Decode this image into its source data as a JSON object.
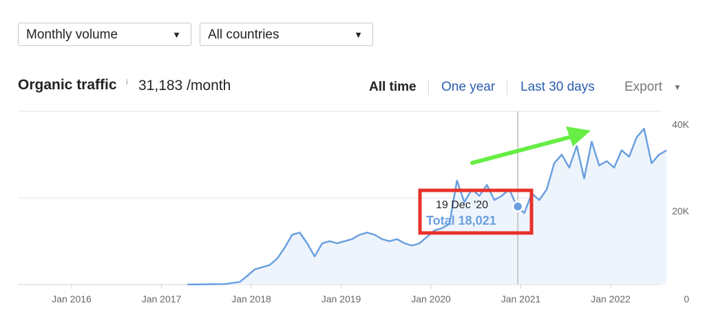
{
  "filters": {
    "volume": {
      "value": "Monthly volume"
    },
    "country": {
      "value": "All countries"
    }
  },
  "header": {
    "title": "Organic traffic",
    "info_mark": "i",
    "total": "31,183 /month"
  },
  "ranges": {
    "all": "All time",
    "year": "One year",
    "days30": "Last 30 days",
    "active": "All time"
  },
  "export": {
    "label": "Export"
  },
  "icons": {
    "dropdown": "caret-down-icon",
    "info": "info-icon"
  },
  "colors": {
    "line": "#6a9fe0",
    "area": "#eef4fc",
    "annotation_box": "#e8312a",
    "trend_arrow": "#66ee44",
    "link": "#2a5db0"
  },
  "tooltip": {
    "date": "19 Dec '20",
    "total": "Total 18,021"
  },
  "chart_data": {
    "type": "area",
    "title": "Organic traffic",
    "xlabel": "",
    "ylabel": "",
    "ylim": [
      0,
      40000
    ],
    "y_ticks": [
      "40K",
      "20K",
      "0"
    ],
    "x_ticks": [
      "Jan 2016",
      "Jan 2017",
      "Jan 2018",
      "Jan 2019",
      "Jan 2020",
      "Jan 2021",
      "Jan 2022"
    ],
    "grid": true,
    "series": [
      {
        "points": [
          [
            "2017-04",
            0
          ],
          [
            "2017-09",
            100
          ],
          [
            "2017-11",
            600
          ],
          [
            "2017-12",
            2000
          ],
          [
            "2018-01",
            3500
          ],
          [
            "2018-02",
            4000
          ],
          [
            "2018-03",
            4500
          ],
          [
            "2018-04",
            6000
          ],
          [
            "2018-05",
            8500
          ],
          [
            "2018-06",
            11500
          ],
          [
            "2018-07",
            12000
          ],
          [
            "2018-08",
            9500
          ],
          [
            "2018-09",
            6500
          ],
          [
            "2018-10",
            9500
          ],
          [
            "2018-11",
            10000
          ],
          [
            "2018-12",
            9500
          ],
          [
            "2019-01",
            10000
          ],
          [
            "2019-02",
            10500
          ],
          [
            "2019-03",
            11500
          ],
          [
            "2019-04",
            12000
          ],
          [
            "2019-05",
            11500
          ],
          [
            "2019-06",
            10500
          ],
          [
            "2019-07",
            10000
          ],
          [
            "2019-08",
            10500
          ],
          [
            "2019-09",
            9500
          ],
          [
            "2019-10",
            9000
          ],
          [
            "2019-11",
            9500
          ],
          [
            "2019-12",
            11000
          ],
          [
            "2020-01",
            12500
          ],
          [
            "2020-02",
            13000
          ],
          [
            "2020-03",
            14000
          ],
          [
            "2020-04",
            24000
          ],
          [
            "2020-05",
            19000
          ],
          [
            "2020-06",
            22000
          ],
          [
            "2020-07",
            20500
          ],
          [
            "2020-08",
            23000
          ],
          [
            "2020-09",
            19500
          ],
          [
            "2020-10",
            20500
          ],
          [
            "2020-11",
            22000
          ],
          [
            "2020-12",
            18021
          ],
          [
            "2021-01",
            16500
          ],
          [
            "2021-02",
            21000
          ],
          [
            "2021-03",
            19500
          ],
          [
            "2021-04",
            22000
          ],
          [
            "2021-05",
            28000
          ],
          [
            "2021-06",
            30000
          ],
          [
            "2021-07",
            27000
          ],
          [
            "2021-08",
            32000
          ],
          [
            "2021-09",
            24500
          ],
          [
            "2021-10",
            33000
          ],
          [
            "2021-11",
            27500
          ],
          [
            "2021-12",
            28500
          ],
          [
            "2022-01",
            27000
          ],
          [
            "2022-02",
            31000
          ],
          [
            "2022-03",
            29500
          ],
          [
            "2022-04",
            34000
          ],
          [
            "2022-05",
            36000
          ],
          [
            "2022-06",
            28000
          ],
          [
            "2022-07",
            30000
          ],
          [
            "2022-08",
            31000
          ]
        ]
      }
    ],
    "highlight": {
      "date": "2020-12-19",
      "value": 18021
    }
  }
}
